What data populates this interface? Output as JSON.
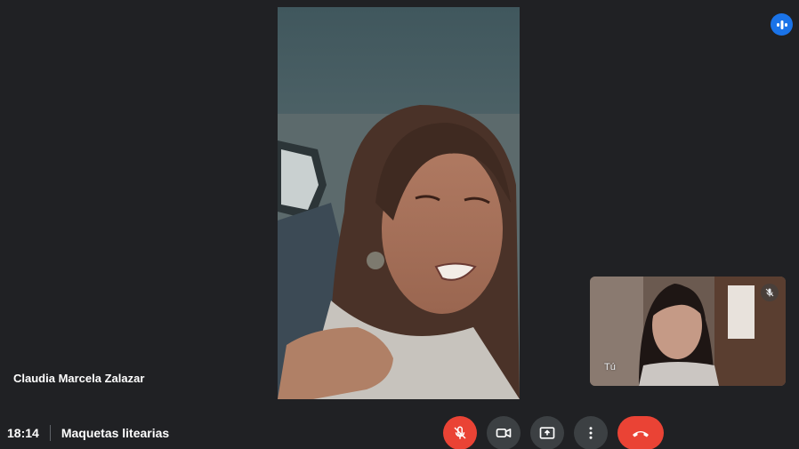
{
  "meeting": {
    "time": "18:14",
    "title": "Maquetas litearias"
  },
  "main_tile": {
    "participant_name": "Claudia Marcela Zalazar"
  },
  "self_tile": {
    "label": "Tú",
    "mic_state": "muted"
  },
  "controls": [
    {
      "name": "microphone",
      "icon": "mic-off-icon",
      "state": "off",
      "color": "#ea4335"
    },
    {
      "name": "camera",
      "icon": "videocam-icon",
      "state": "on",
      "color": "#3c4043"
    },
    {
      "name": "present",
      "icon": "present-screen-icon",
      "state": "idle",
      "color": "#3c4043"
    },
    {
      "name": "more-options",
      "icon": "more-vert-icon",
      "state": "idle",
      "color": "#3c4043"
    },
    {
      "name": "leave-call",
      "icon": "call-end-icon",
      "state": "idle",
      "color": "#ea4335"
    }
  ],
  "colors": {
    "background": "#202124",
    "accent": "#1a73e8",
    "danger": "#ea4335",
    "button": "#3c4043"
  }
}
